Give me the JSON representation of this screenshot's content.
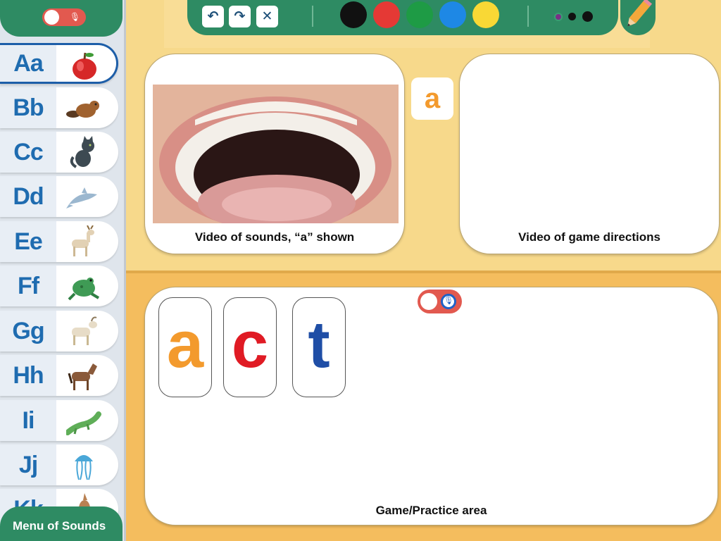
{
  "sidebar": {
    "mic_toggle": {
      "state": "off",
      "icon": "microphone-muted-icon"
    },
    "letters": [
      {
        "label": "Aa",
        "picture": "apple-icon",
        "selected": true
      },
      {
        "label": "Bb",
        "picture": "beaver-icon"
      },
      {
        "label": "Cc",
        "picture": "cat-icon"
      },
      {
        "label": "Dd",
        "picture": "dolphin-icon"
      },
      {
        "label": "Ee",
        "picture": "elk-icon"
      },
      {
        "label": "Ff",
        "picture": "frog-icon"
      },
      {
        "label": "Gg",
        "picture": "goat-icon"
      },
      {
        "label": "Hh",
        "picture": "horse-icon"
      },
      {
        "label": "Ii",
        "picture": "iguana-icon"
      },
      {
        "label": "Jj",
        "picture": "jellyfish-icon"
      },
      {
        "label": "Kk",
        "picture": "kangaroo-icon"
      }
    ],
    "menu_label": "Menu of Sounds"
  },
  "toolbar": {
    "buttons": [
      {
        "name": "undo",
        "icon": "undo-icon"
      },
      {
        "name": "redo",
        "icon": "redo-icon"
      },
      {
        "name": "clear",
        "icon": "close-icon"
      }
    ],
    "colors": [
      "#111111",
      "#e53935",
      "#1e9b45",
      "#1e88e5",
      "#f9d835"
    ],
    "stroke_sizes": [
      "small",
      "medium",
      "large"
    ],
    "pencil_icon": "pencil-icon"
  },
  "sound_panel": {
    "caption": "Video of sounds, “a” shown",
    "current_letter": "a"
  },
  "directions_panel": {
    "caption": "Video of game directions"
  },
  "game_panel": {
    "caption": "Game/Practice area",
    "mic_toggle": {
      "state": "on",
      "icon": "microphone-icon"
    },
    "tiles": [
      {
        "letter": "a",
        "color": "#f39a2d"
      },
      {
        "letter": "c",
        "color": "#e01b24"
      },
      {
        "letter": "t",
        "color": "#1f4ea6"
      }
    ]
  }
}
